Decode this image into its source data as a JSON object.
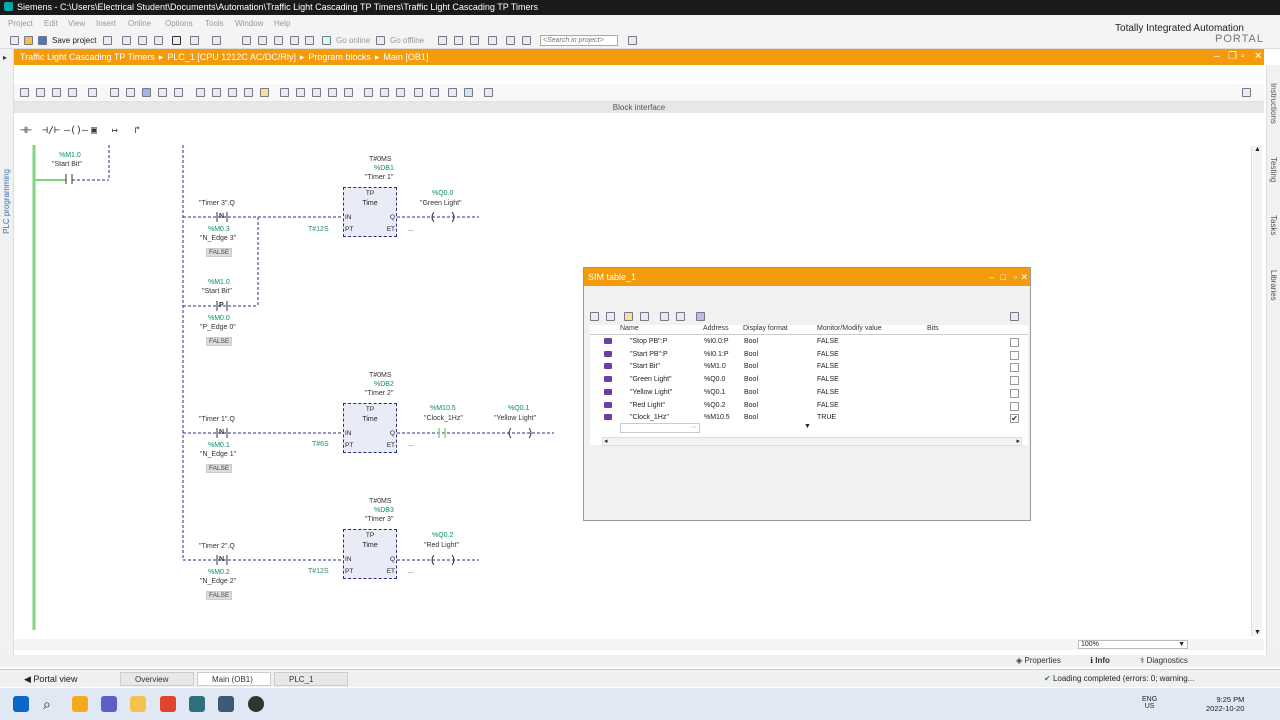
{
  "window": {
    "app": "Siemens",
    "path": "C:\\Users\\Electrical Student\\Documents\\Automation\\Traffic Light Cascading TP Timers\\Traffic Light Cascading TP Timers"
  },
  "menu": [
    "Project",
    "Edit",
    "View",
    "Insert",
    "Online",
    "Options",
    "Tools",
    "Window",
    "Help"
  ],
  "toolbar": {
    "save_project": "Save project",
    "go_online": "Go online",
    "go_offline": "Go offline",
    "search_placeholder": "<Search in project>"
  },
  "brand": {
    "line1": "Totally Integrated Automation",
    "line2": "PORTAL"
  },
  "breadcrumb": [
    "Traffic Light Cascading TP Timers",
    "PLC_1 [CPU 1212C AC/DC/Rly]",
    "Program blocks",
    "Main [OB1]"
  ],
  "left_tab": "PLC programming",
  "right_tabs": [
    "Instructions",
    "Testing",
    "Tasks",
    "Libraries"
  ],
  "block_interface": "Block interface",
  "ladder": {
    "start_bit_contact": {
      "addr": "%M1.0",
      "tag": "\"Start Bit\""
    },
    "networks": [
      {
        "timer": {
          "preset": "T#0MS",
          "db": "%DB1",
          "name": "\"Timer 1\"",
          "type": "TP",
          "sub": "Time",
          "pt": "T#12S"
        },
        "input_tag": "\"Timer 3\".Q",
        "edge1": {
          "addr": "%M0.3",
          "tag": "\"N_Edge 3\"",
          "state": "FALSE"
        },
        "edge2_in": {
          "addr": "%M1.0",
          "tag": "\"Start Bit\""
        },
        "edge2": {
          "addr": "%M0.0",
          "tag": "\"P_Edge 0\"",
          "state": "FALSE"
        },
        "output": {
          "addr": "%Q0.0",
          "tag": "\"Green Light\""
        }
      },
      {
        "timer": {
          "preset": "T#0MS",
          "db": "%DB2",
          "name": "\"Timer 2\"",
          "type": "TP",
          "sub": "Time",
          "pt": "T#6S"
        },
        "input_tag": "\"Timer 1\".Q",
        "edge1": {
          "addr": "%M0.1",
          "tag": "\"N_Edge 1\"",
          "state": "FALSE"
        },
        "clock": {
          "addr": "%M10.5",
          "tag": "\"Clock_1Hz\""
        },
        "output": {
          "addr": "%Q0.1",
          "tag": "\"Yellow Light\""
        }
      },
      {
        "timer": {
          "preset": "T#0MS",
          "db": "%DB3",
          "name": "\"Timer 3\"",
          "type": "TP",
          "sub": "Time",
          "pt": "T#12S"
        },
        "input_tag": "\"Timer 2\".Q",
        "edge1": {
          "addr": "%M0.2",
          "tag": "\"N_Edge 2\"",
          "state": "FALSE"
        },
        "output": {
          "addr": "%Q0.2",
          "tag": "\"Red Light\""
        }
      }
    ],
    "pin_in": "IN",
    "pin_pt": "PT",
    "pin_q": "Q",
    "pin_et": "ET",
    "ellipsis": "..."
  },
  "sim_table": {
    "title": "SIM table_1",
    "columns": [
      "Name",
      "Address",
      "Display format",
      "Monitor/Modify value",
      "Bits"
    ],
    "rows": [
      {
        "name": "\"Stop PB\":P",
        "address": "%I0.0:P",
        "format": "Bool",
        "value": "FALSE",
        "bits": false
      },
      {
        "name": "\"Start PB\":P",
        "address": "%I0.1:P",
        "format": "Bool",
        "value": "FALSE",
        "bits": false
      },
      {
        "name": "\"Start Bit\"",
        "address": "%M1.0",
        "format": "Bool",
        "value": "FALSE",
        "bits": false
      },
      {
        "name": "\"Green Light\"",
        "address": "%Q0.0",
        "format": "Bool",
        "value": "FALSE",
        "bits": false
      },
      {
        "name": "\"Yellow Light\"",
        "address": "%Q0.1",
        "format": "Bool",
        "value": "FALSE",
        "bits": false
      },
      {
        "name": "\"Red Light\"",
        "address": "%Q0.2",
        "format": "Bool",
        "value": "FALSE",
        "bits": false
      },
      {
        "name": "\"Clock_1Hz\"",
        "address": "%M10.5",
        "format": "Bool",
        "value": "TRUE",
        "bits": true
      }
    ],
    "check_mark": "✔"
  },
  "zoom": "100%",
  "info_tabs": [
    "Properties",
    "Info",
    "Diagnostics"
  ],
  "portal": {
    "portal_view": "Portal view",
    "tabs": [
      "Overview",
      "Main (OB1)",
      "PLC_1"
    ],
    "status": "Loading completed (errors: 0; warning..."
  },
  "taskbar": {
    "lang1": "ENG",
    "lang2": "US",
    "time": "9:25 PM",
    "date": "2022-10-20"
  },
  "colors": {
    "accent": "#f39b0d",
    "wire": "#2b2a8a",
    "power": "#7fd67f",
    "tag_green": "#0a8a6a"
  }
}
